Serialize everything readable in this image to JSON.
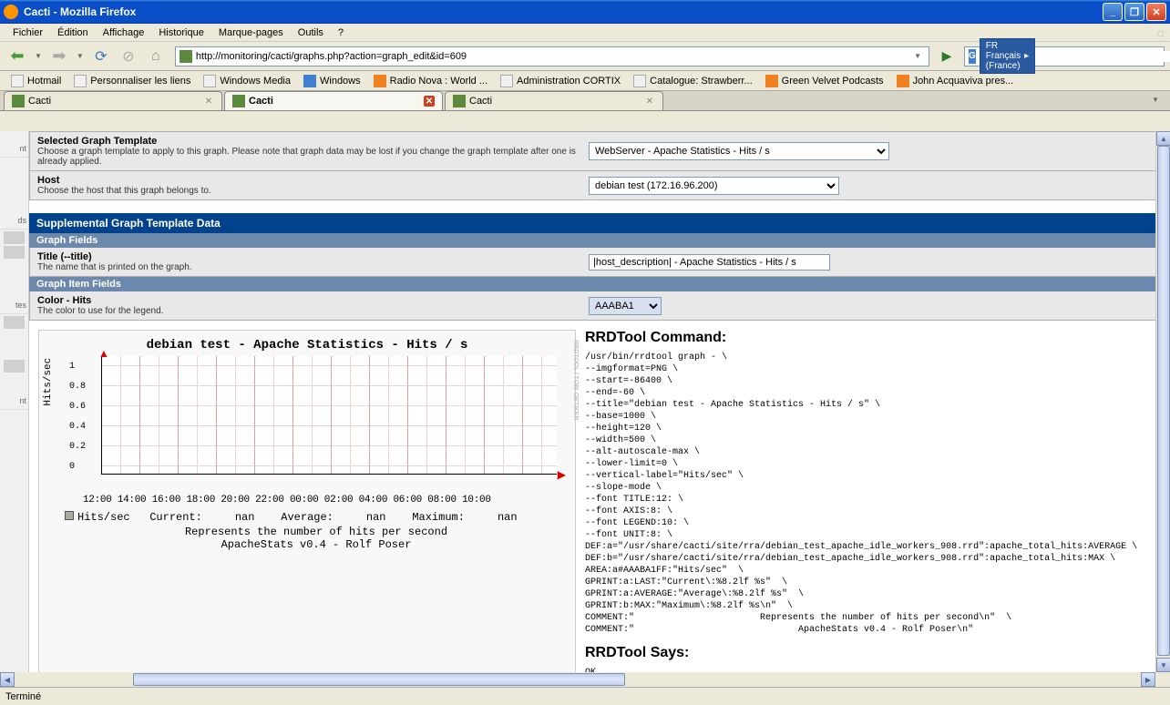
{
  "window": {
    "title": "Cacti - Mozilla Firefox"
  },
  "menu": {
    "file": "Fichier",
    "edit": "Édition",
    "view": "Affichage",
    "history": "Historique",
    "bookmarks": "Marque-pages",
    "tools": "Outils",
    "help": "?"
  },
  "urlbar": {
    "value": "http://monitoring/cacti/graphs.php?action=graph_edit&id=609"
  },
  "search": {
    "lang": "FR Français (France)",
    "placeholder": ""
  },
  "bookmarks": {
    "items": [
      "Hotmail",
      "Personnaliser les liens",
      "Windows Media",
      "Windows",
      "Radio Nova : World ...",
      "Administration CORTIX",
      "Catalogue: Strawberr...",
      "Green Velvet Podcasts",
      "John Acquaviva pres..."
    ]
  },
  "tabs": {
    "t1": "Cacti",
    "t2": "Cacti",
    "t3": "Cacti"
  },
  "form": {
    "template": {
      "label": "Selected Graph Template",
      "desc": "Choose a graph template to apply to this graph. Please note that graph data may be lost if you change the graph template after one is already applied.",
      "value": "WebServer - Apache Statistics - Hits / s"
    },
    "host": {
      "label": "Host",
      "desc": "Choose the host that this graph belongs to.",
      "value": "debian test (172.16.96.200)"
    },
    "section1": "Supplemental Graph Template Data",
    "subsection1": "Graph Fields",
    "title": {
      "label": "Title (--title)",
      "desc": "The name that is printed on the graph.",
      "value": "|host_description| - Apache Statistics - Hits / s"
    },
    "subsection2": "Graph Item Fields",
    "color": {
      "label": "Color - Hits",
      "desc": "The color to use for the legend.",
      "value": "AAABA1"
    }
  },
  "rrd": {
    "title1": "RRDTool Command:",
    "command": "/usr/bin/rrdtool graph - \\\n--imgformat=PNG \\\n--start=-86400 \\\n--end=-60 \\\n--title=\"debian test - Apache Statistics - Hits / s\" \\\n--base=1000 \\\n--height=120 \\\n--width=500 \\\n--alt-autoscale-max \\\n--lower-limit=0 \\\n--vertical-label=\"Hits/sec\" \\\n--slope-mode \\\n--font TITLE:12: \\\n--font AXIS:8: \\\n--font LEGEND:10: \\\n--font UNIT:8: \\\nDEF:a=\"/usr/share/cacti/site/rra/debian_test_apache_idle_workers_908.rrd\":apache_total_hits:AVERAGE \\\nDEF:b=\"/usr/share/cacti/site/rra/debian_test_apache_idle_workers_908.rrd\":apache_total_hits:MAX \\\nAREA:a#AAABA1FF:\"Hits/sec\"  \\\nGPRINT:a:LAST:\"Current\\:%8.2lf %s\"  \\\nGPRINT:a:AVERAGE:\"Average\\:%8.2lf %s\"  \\\nGPRINT:b:MAX:\"Maximum\\:%8.2lf %s\\n\"  \\\nCOMMENT:\"                       Represents the number of hits per second\\n\"  \\\nCOMMENT:\"                              ApacheStats v0.4 - Rolf Poser\\n\" ",
    "title2": "RRDTool Says:",
    "says": "OK"
  },
  "sidebar": {
    "s1": "nt",
    "s2": "ds",
    "s3": "tes",
    "s4": "nt"
  },
  "status": {
    "text": "Terminé"
  },
  "chart_data": {
    "type": "line",
    "title": "debian test - Apache Statistics - Hits / s",
    "ylabel": "Hits/sec",
    "xlabel": "",
    "x_ticks": [
      "12:00",
      "14:00",
      "16:00",
      "18:00",
      "20:00",
      "22:00",
      "00:00",
      "02:00",
      "04:00",
      "06:00",
      "08:00",
      "10:00"
    ],
    "y_ticks": [
      0.0,
      0.2,
      0.4,
      0.6,
      0.8,
      1.0
    ],
    "ylim": [
      0,
      1.05
    ],
    "series": [
      {
        "name": "Hits/sec",
        "values": [],
        "color": "#AAABA1"
      }
    ],
    "legend_stats": {
      "label": "Hits/sec",
      "current": "nan",
      "average": "nan",
      "maximum": "nan",
      "current_label": "Current:",
      "average_label": "Average:",
      "maximum_label": "Maximum:"
    },
    "comment1": "Represents the number of hits per second",
    "comment2": "ApacheStats v0.4 - Rolf Poser",
    "watermark": "RRDTOOL / TOBI OETIKER"
  }
}
